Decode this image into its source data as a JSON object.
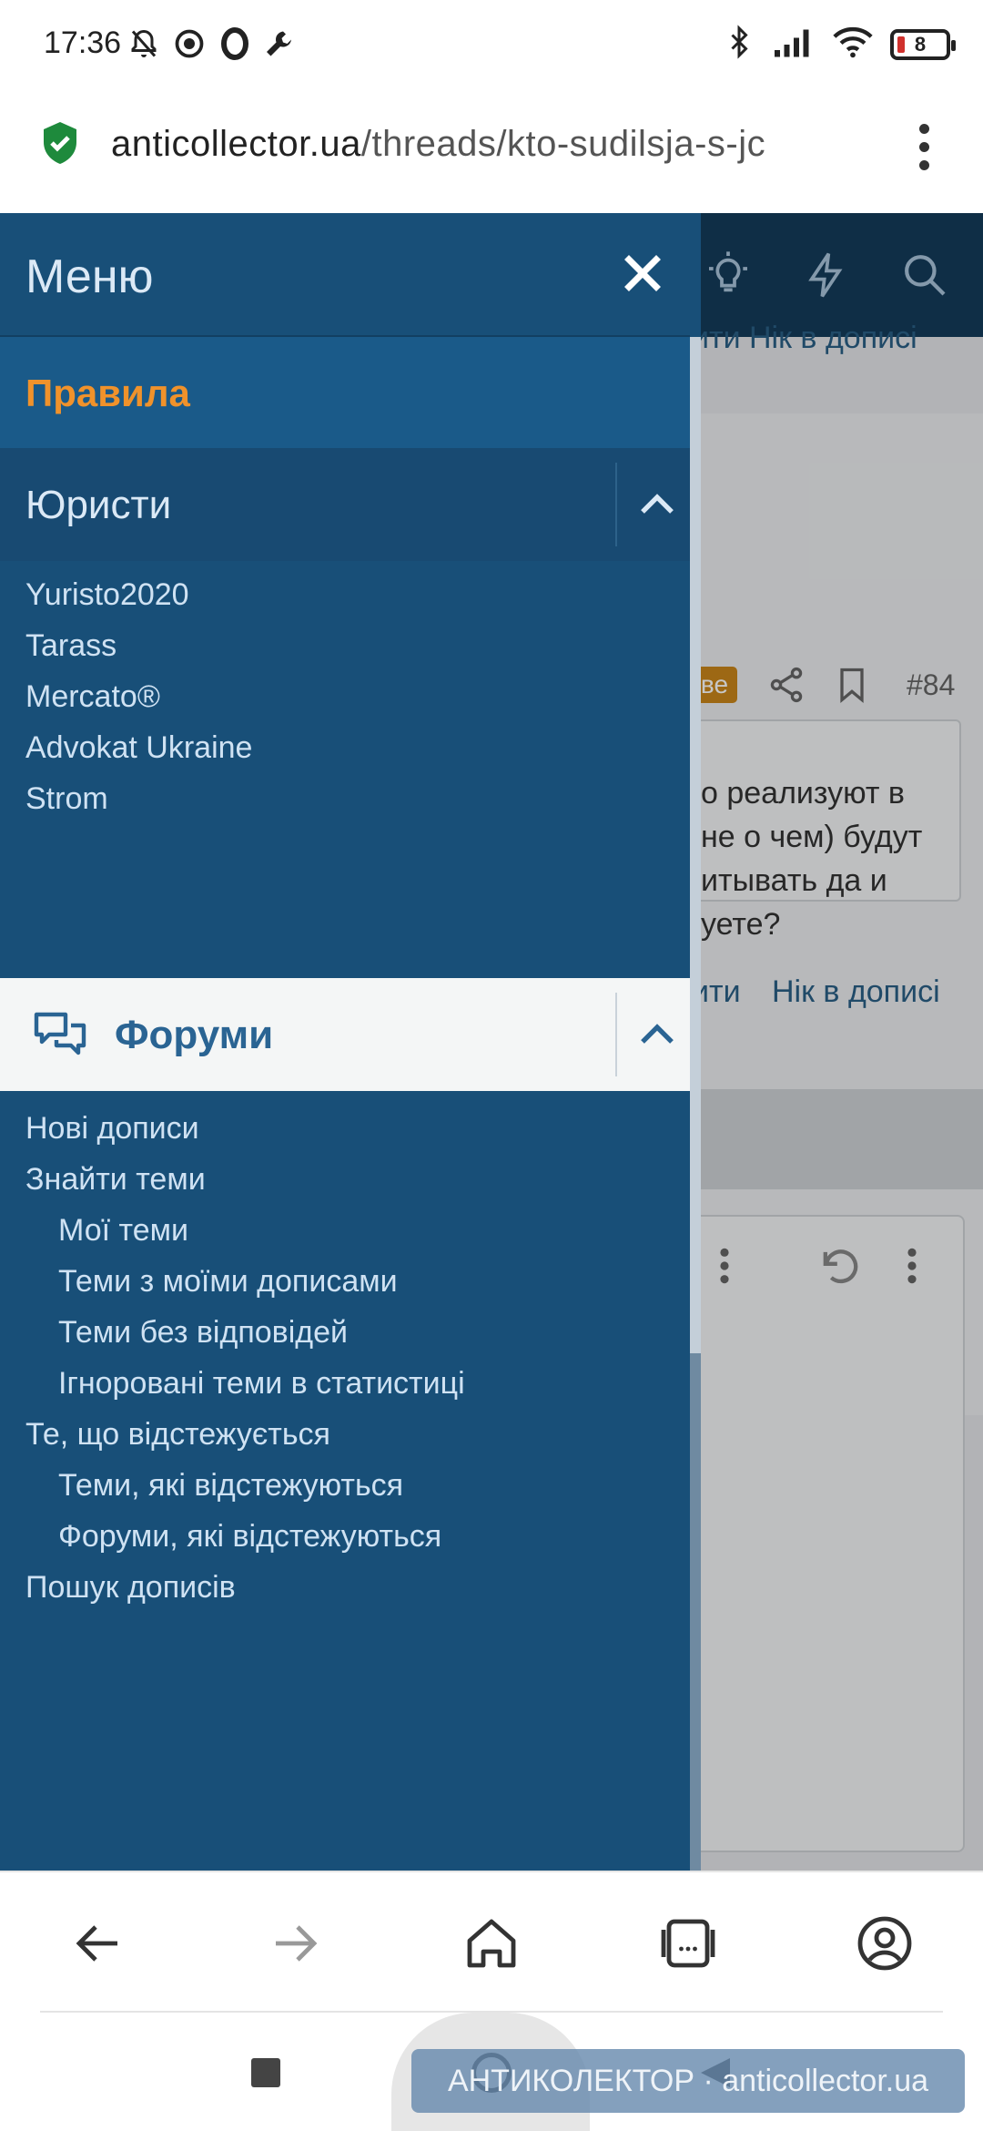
{
  "status_bar": {
    "time": "17:36",
    "battery": "8"
  },
  "browser": {
    "url_host": "anticollector.ua",
    "url_path": "/threads/kto-sudilsja-s-jc"
  },
  "background_page": {
    "top_links": "ити   Нік в дописі",
    "badge": "ве",
    "post_number": "#84",
    "quote_lines": [
      "о реализуют в",
      "не о чем) будут",
      "итывать да и",
      "уете?"
    ],
    "link_1": "ити",
    "link_2": "Нік в дописі"
  },
  "drawer": {
    "title": "Меню",
    "rules": "Правила",
    "lawyers": {
      "label": "Юристи",
      "items": [
        "Yuristo2020",
        "Tarass",
        "Mercato®",
        "Advokat Ukraine",
        "Strom"
      ]
    },
    "forums": {
      "label": "Форуми",
      "items": [
        {
          "label": "Нові дописи",
          "indent": false
        },
        {
          "label": "Знайти теми",
          "indent": false
        },
        {
          "label": "Мої теми",
          "indent": true
        },
        {
          "label": "Теми з моїми дописами",
          "indent": true
        },
        {
          "label": "Теми без відповідей",
          "indent": true
        },
        {
          "label": "Ігноровані теми в статистиці",
          "indent": true
        },
        {
          "label": "Те, що відстежується",
          "indent": false
        },
        {
          "label": "Теми, які відстежуються",
          "indent": true
        },
        {
          "label": "Форуми, які відстежуються",
          "indent": true
        },
        {
          "label": "Пошук дописів",
          "indent": false
        }
      ]
    }
  },
  "watermark": "АНТИКОЛЕКТОР · anticollector.ua",
  "colors": {
    "drawer_bg": "#184f78",
    "rules_accent": "#f0922b",
    "forum_label": "#2a6493"
  }
}
